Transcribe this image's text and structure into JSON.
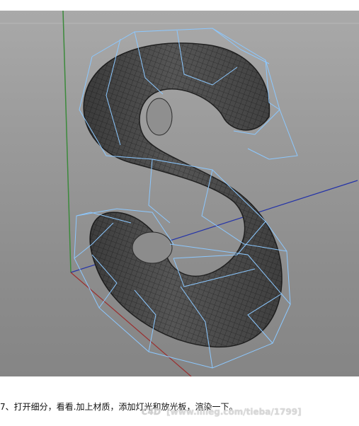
{
  "viewport": {
    "background_color": "#969696",
    "axis_colors": {
      "x": "#9b2f2f",
      "y": "#3b8a3b",
      "z": "#2433a8"
    },
    "cage_color": "#8cc8ff",
    "mesh_color": "#3a3a3a",
    "model": "subdivided-letter-s"
  },
  "caption": {
    "text": "7、打开细分，看看.加上材质，添加灯光和放光板，渲染一下。"
  },
  "watermark": {
    "logo": "C4D",
    "text": "[www.illieg.com/tieba/1799]"
  }
}
